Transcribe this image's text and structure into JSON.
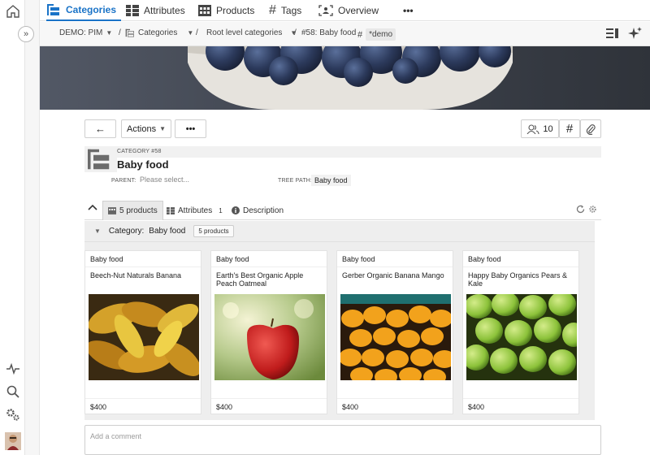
{
  "tabs": {
    "categories": "Categories",
    "attributes": "Attributes",
    "products": "Products",
    "tags": "Tags",
    "overview": "Overview",
    "more": "•••"
  },
  "breadcrumb": {
    "demo": "DEMO: PIM",
    "categories": "Categories",
    "root": "Root level categories",
    "current": "#58: Baby food",
    "tag": "*demo"
  },
  "toolbar": {
    "back": "←",
    "actions": "Actions",
    "more": "•••",
    "users_count": "10"
  },
  "category": {
    "label": "CATEGORY #58",
    "name": "Baby food",
    "parent_label": "PARENT:",
    "parent_placeholder": "Please select...",
    "treepath_label": "TREE PATH:",
    "treepath_value": "Baby food"
  },
  "subtabs": {
    "products": "5 products",
    "attributes": "Attributes",
    "attributes_count": "1",
    "description": "Description"
  },
  "group": {
    "label": "Category:",
    "value": "Baby food",
    "count": "5 products"
  },
  "products": [
    {
      "category": "Baby food",
      "name": "Beech-Nut Naturals Banana",
      "price": "$400"
    },
    {
      "category": "Baby food",
      "name": "Earth's Best Organic Apple Peach Oatmeal",
      "price": "$400"
    },
    {
      "category": "Baby food",
      "name": "Gerber Organic Banana Mango",
      "price": "$400"
    },
    {
      "category": "Baby food",
      "name": "Happy Baby Organics Pears & Kale",
      "price": "$400"
    }
  ],
  "comment": {
    "placeholder": "Add a comment"
  },
  "colors": {
    "accent": "#1a73c7"
  }
}
